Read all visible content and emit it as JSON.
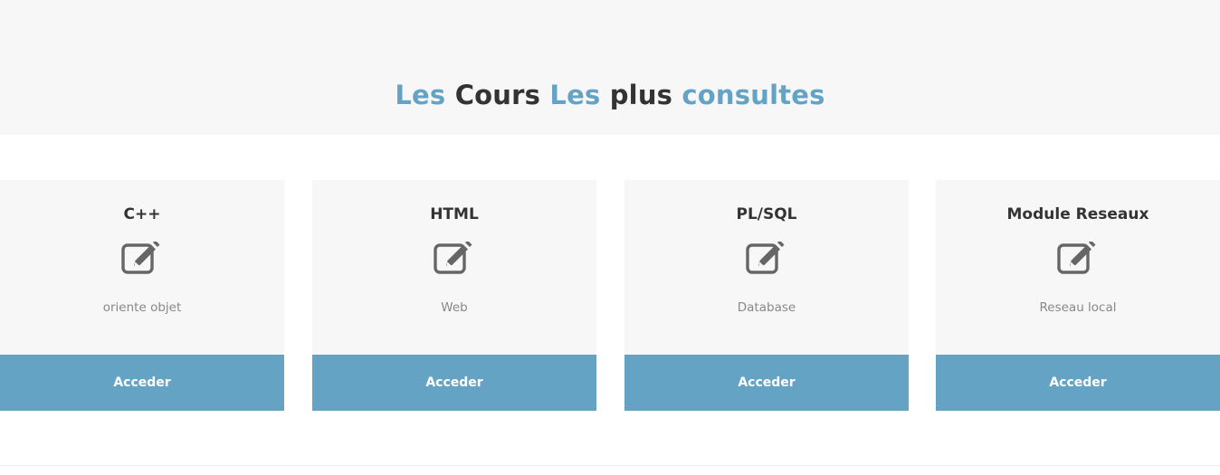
{
  "hero": {
    "title_words": [
      "Les",
      "Cours",
      "Les",
      "plus",
      "consultes"
    ],
    "background": "#f7f7f7"
  },
  "colors": {
    "accent": "#65a3c4",
    "dark_text": "#333333",
    "muted_text": "#888888",
    "card_bg": "#f7f7f7",
    "icon": "#666666"
  },
  "courses": [
    {
      "title": "C++",
      "icon": "edit-icon",
      "description": "oriente objet",
      "button_label": "Acceder"
    },
    {
      "title": "HTML",
      "icon": "edit-icon",
      "description": "Web",
      "button_label": "Acceder"
    },
    {
      "title": "PL/SQL",
      "icon": "edit-icon",
      "description": "Database",
      "button_label": "Acceder"
    },
    {
      "title": "Module Reseaux",
      "icon": "edit-icon",
      "description": "Reseau local",
      "button_label": "Acceder"
    }
  ]
}
